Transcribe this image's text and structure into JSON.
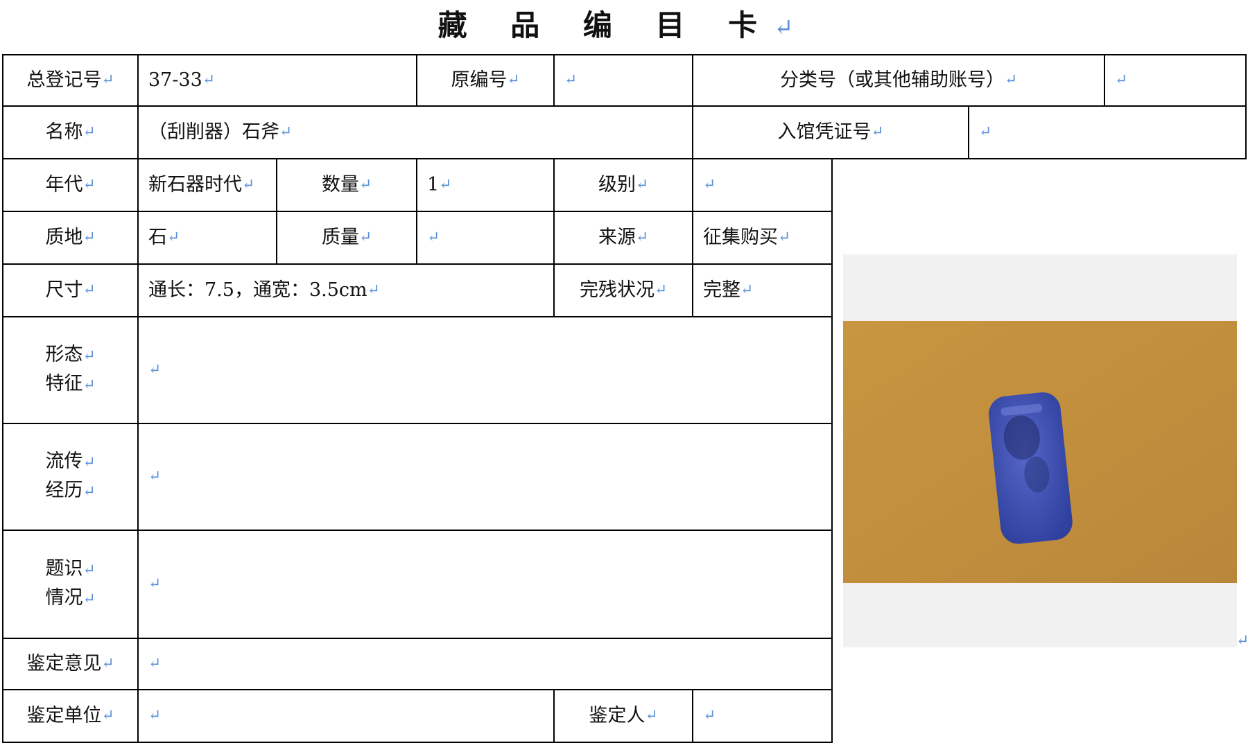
{
  "title": "藏 品 编 目 卡",
  "return_mark": "↵",
  "fields": {
    "registration_no": {
      "label": "总登记号",
      "value": "37-33"
    },
    "original_no": {
      "label": "原编号",
      "value": ""
    },
    "classification_no": {
      "label": "分类号（或其他辅助账号）",
      "value": ""
    },
    "name": {
      "label": "名称",
      "value": "（刮削器）石斧"
    },
    "entry_voucher_no": {
      "label": "入馆凭证号",
      "value": ""
    },
    "era": {
      "label": "年代",
      "value": "新石器时代"
    },
    "quantity": {
      "label": "数量",
      "value": "1"
    },
    "grade": {
      "label": "级别",
      "value": ""
    },
    "material": {
      "label": "质地",
      "value": "石"
    },
    "weight": {
      "label": "质量",
      "value": ""
    },
    "source": {
      "label": "来源",
      "value": "征集购买"
    },
    "dimensions": {
      "label": "尺寸",
      "value": "通长：7.5，通宽：3.5cm"
    },
    "condition": {
      "label": "完残状况",
      "value": "完整"
    },
    "form_features": {
      "label_line1": "形态",
      "label_line2": "特征",
      "value": ""
    },
    "provenance": {
      "label_line1": "流传",
      "label_line2": "经历",
      "value": ""
    },
    "inscriptions": {
      "label_line1": "题识",
      "label_line2": "情况",
      "value": ""
    },
    "appraisal_opinion": {
      "label": "鉴定意见",
      "value": ""
    },
    "appraisal_unit": {
      "label": "鉴定单位",
      "value": ""
    },
    "appraiser": {
      "label": "鉴定人",
      "value": ""
    }
  },
  "photo": {
    "icon": "artifact-photo",
    "background_color": "#c9963f",
    "object_color": "#3c4fb0"
  }
}
